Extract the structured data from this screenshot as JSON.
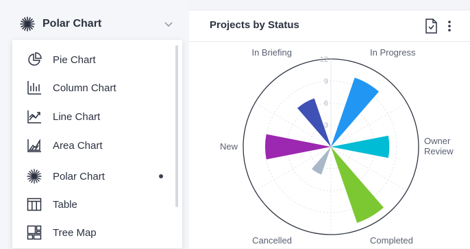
{
  "selector": {
    "label": "Polar Chart",
    "icon": "polar-chart-icon",
    "chevron_icon": "chevron-down-icon"
  },
  "menu": {
    "items": [
      {
        "label": "Pie Chart",
        "icon": "pie-chart-icon"
      },
      {
        "label": "Column Chart",
        "icon": "column-chart-icon"
      },
      {
        "label": "Line Chart",
        "icon": "line-chart-icon"
      },
      {
        "label": "Area Chart",
        "icon": "area-chart-icon"
      },
      {
        "label": "Polar Chart",
        "icon": "polar-chart-icon",
        "selected": true
      },
      {
        "label": "Table",
        "icon": "table-icon"
      },
      {
        "label": "Tree Map",
        "icon": "tree-map-icon"
      }
    ]
  },
  "panel": {
    "title": "Projects by Status",
    "export_icon": "file-export-icon",
    "more_icon": "more-vertical-icon"
  },
  "chart_data": {
    "type": "polar",
    "title": "Projects by Status",
    "categories": [
      "In Progress",
      "Owner Review",
      "Completed",
      "Cancelled",
      "New",
      "In Briefing"
    ],
    "category_labels": [
      "In Progress",
      "Owner\nReview",
      "Completed",
      "Cancelled",
      "New",
      "In Briefing"
    ],
    "values": [
      10,
      8,
      11,
      4,
      9,
      7
    ],
    "colors": [
      "#2196f3",
      "#00bcd4",
      "#7cc832",
      "#a9b8c8",
      "#9c27b0",
      "#3f51b5"
    ],
    "radial_ticks": [
      3,
      6,
      9,
      12
    ],
    "rlim": [
      0,
      12
    ],
    "grid": true,
    "legend": "none"
  }
}
